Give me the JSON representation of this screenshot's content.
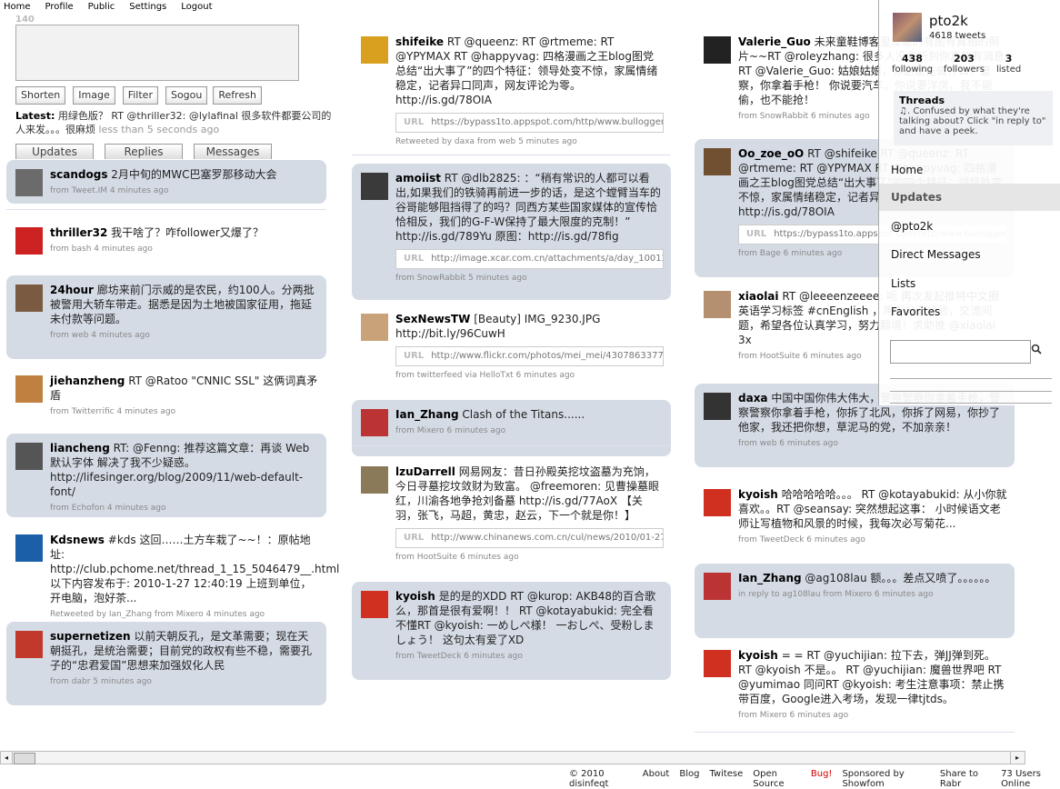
{
  "nav": [
    "Home",
    "Profile",
    "Public",
    "Settings",
    "Logout"
  ],
  "compose": {
    "counter": "140"
  },
  "toolbar": [
    "Shorten",
    "Image",
    "Filter",
    "Sogou",
    "Refresh"
  ],
  "latest": {
    "label": "Latest:",
    "text": "用绿色版？ RT @thriller32: @lylafinal 很多软件都要公司的人来发。。。很麻烦",
    "meta": "less than 5 seconds ago"
  },
  "tabs": [
    "Updates",
    "Replies",
    "Messages"
  ],
  "col1": [
    {
      "user": "scandogs",
      "text": "2月中旬的MWC巴塞罗那移动大会",
      "meta": "from Tweet.IM  4 minutes ago",
      "avatar": "#6b6b6b"
    },
    {
      "user": "thriller32",
      "text": "我干啥了？咋follower又爆了？",
      "meta": "from bash  4 minutes ago",
      "avatar": "#cc2222"
    },
    {
      "user": "24hour",
      "text": "廊坊来前门示威的是农民，约100人。分两批被警用大轿车带走。据悉是因为土地被国家征用，拖延未付款等问题。",
      "meta": "from web  4 minutes ago",
      "avatar": "#7a5a40"
    },
    {
      "user": "jiehanzheng",
      "text": "RT @Ratoo \"CNNIC SSL\" 这俩词真矛盾",
      "meta": "from Twitterrific  4 minutes ago",
      "avatar": "#c08040"
    },
    {
      "user": "liancheng",
      "text": "RT: @Fenng: 推荐这篇文章：再谈 Web 默认字体 解决了我不少疑惑。 http://lifesinger.org/blog/2009/11/web-default-font/",
      "meta": "from Echofon  4 minutes ago",
      "avatar": "#555555"
    },
    {
      "user": "Kdsnews",
      "text": "#kds 这回……土方车栽了~~！：原帖地址: http://club.pchome.net/thread_1_15_5046479__.html 以下内容发布于: 2010-1-27 12:40:19 上班到单位，开电脑，泡好茶...",
      "meta": "Retweeted by Ian_Zhang from Mixero  4 minutes ago",
      "avatar": "#1a5fa8"
    },
    {
      "user": "supernetizen",
      "text": "以前天朝反孔，是文革需要；现在天朝挺孔，是统治需要；目前党的政权有些不稳，需要孔子的“忠君爱国”思想来加强奴化人民",
      "meta": "from dabr  5 minutes ago",
      "avatar": "#c0392b"
    }
  ],
  "col2": [
    {
      "user": "shifeike",
      "text": "RT @queenz: RT @rtmeme: RT @YPYMAX RT @happyvag: 四格漫画之王blog图党总结“出大事了”的四个特征：领导处变不惊，家属情绪稳定，记者异口同声，网友评论为零。http://is.gd/78OIA",
      "url": "https://bypass1to.appspot.com/http/www.bullogger",
      "meta": "Retweeted by daxa from web  5 minutes ago",
      "avatar": "#d9a020"
    },
    {
      "user": "amoiist",
      "text": "RT @dlb2825: ：“稍有常识的人都可以看出,如果我们的铁骑再前进一步的话，是这个螳臂当车的谷哥能够阻挡得了的吗？同西方某些国家媒体的宣传恰恰相反，我们的G-F-W保持了最大限度的克制！” http://is.gd/789Yu 原图：http://is.gd/78fig",
      "url": "http://image.xcar.com.cn/attachments/a/day_10012",
      "meta": "from SnowRabbit  5 minutes ago",
      "avatar": "#3a3a3a"
    },
    {
      "user": "SexNewsTW",
      "text": "[Beauty] IMG_9230.JPG http://bit.ly/96CuwH",
      "url": "http://www.flickr.com/photos/mei_mei/4307863377/",
      "meta": "from twitterfeed via HelloTxt  6 minutes ago",
      "avatar": "#c9a27a"
    },
    {
      "user": "Ian_Zhang",
      "text": "Clash of the Titans......",
      "meta": "from Mixero  6 minutes ago",
      "avatar": "#b33"
    },
    {
      "user": "lzuDarrell",
      "text": "网易网友：昔日孙殿英挖坟盗墓为充饷，今日寻墓挖坟敛财为致富。 @freemoren: 见曹操墓眼红，川渝各地争抢刘备墓 http://is.gd/77AoX 【关羽，张飞，马超，黄忠，赵云，下一个就是你！】",
      "url": "http://www.chinanews.com.cn/cul/news/2010/01-27",
      "meta": "from HootSuite  6 minutes ago",
      "avatar": "#8a7a5a"
    },
    {
      "user": "kyoish",
      "text": "是的是的XDD RT @kurop: AKB48的百合歌么，那首是很有爱啊！！ RT @kotayabukid: 完全看不懂RT @kyoish: 一めしぺ様！ 一おしぺ、受粉しましょう！ 这句太有爱了XD",
      "meta": "from TweetDeck  6 minutes ago",
      "avatar": "#d03020"
    }
  ],
  "col3": [
    {
      "user": "Valerie_Guo",
      "text": "未来童鞋博客里发现的有图有真相的照片~~RT @roleyzhang: 很多人没有听到你真的有消息 RT @Valerie_Guo: 姑娘姑娘，你这是在做什么？警察，你拿着手枪！ 你说要汽车，你说要洋房，我不能偷，也不能抢！",
      "meta": "from SnowRabbit  6 minutes ago",
      "avatar": "#222222"
    },
    {
      "user": "Oo_zoe_oO",
      "text": "RT @shifeike RT @queenz: RT @rtmeme: RT @YPYMAX RT @happyvag: 四格漫画之王blog图党总结“出大事了”的四个特征：领导处变不惊，家属情绪稳定，记者异口同声，网友评论为零。http://is.gd/78OIA",
      "url": "https://bypass1to.appspot.com/http/www.bullogger",
      "meta": "from Bage  6 minutes ago",
      "avatar": "#705030"
    },
    {
      "user": "xiaolai",
      "text": "RT @leeeenzeeee: 呃 再次发起推特中文圈英语学习标签 #cnEnglish ，用于分享经验，交流问题，希望各位认真学习，努力翻墙！求助推 @xiaolai 3x",
      "meta": "from HootSuite  6 minutes ago",
      "avatar": "#b59070"
    },
    {
      "user": "daxa",
      "text": "中国中国你伟大伟大，警察警察你拿着手枪，警察警察你拿着手枪，你拆了北风，你拆了网易，你抄了他家，我还把你想，草泥马的党，不加亲亲！",
      "meta": "from web  6 minutes ago",
      "avatar": "#333333"
    },
    {
      "user": "kyoish",
      "text": "哈哈哈哈哈。。。 RT @kotayabukid: 从小你就喜欢。。RT @seansay: 突然想起这事： 小时候语文老师让写植物和风景的时候，我每次必写菊花...",
      "meta": "from TweetDeck  6 minutes ago",
      "avatar": "#d03020"
    },
    {
      "user": "Ian_Zhang",
      "text": "@ag108lau 额。。。差点又喷了。。。。。。",
      "meta": "in reply to ag108lau from Mixero  6 minutes ago",
      "avatar": "#b33"
    },
    {
      "user": "kyoish",
      "text": "= = RT @yuchijian: 拉下去，弹JJ弹到死。RT @kyoish 不是。。 RT @yuchijian: 魔兽世界吧 RT @yumimao 同问RT @kyoish: 考生注意事项：禁止携带百度，Google进入考场，发现一律tjtds。",
      "meta": "from Mixero  6 minutes ago",
      "avatar": "#d03020"
    }
  ],
  "sidebar": {
    "name": "pto2k",
    "tweets": "4618 tweets",
    "stats": [
      {
        "num": "438",
        "label": "following"
      },
      {
        "num": "203",
        "label": "followers"
      },
      {
        "num": "3",
        "label": "listed"
      }
    ],
    "threads": {
      "title": "Threads",
      "text": "♫. Confused by what they're talking about? Click \"in reply to\" and have a peek."
    },
    "menu": [
      "Home",
      "Updates",
      "@pto2k",
      "Direct Messages",
      "Lists",
      "Favorites"
    ],
    "search_placeholder": ""
  },
  "footer": [
    "© 2010 disinfeqt",
    "About",
    "Blog",
    "Twitese",
    "Open Source",
    "Bug!",
    "Sponsored by Showfom",
    "Share to Rabr",
    "73 Users Online"
  ]
}
